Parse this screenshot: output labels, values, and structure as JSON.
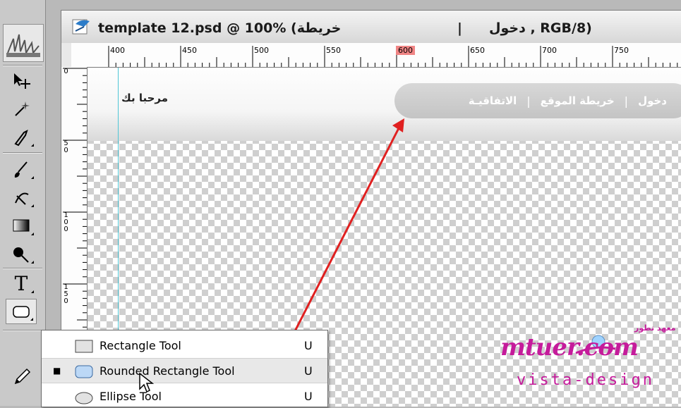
{
  "document": {
    "title_left": "template 12.psd @ 100% (خريطة",
    "title_separator": "|",
    "title_right": "دخول , RGB/8)"
  },
  "ruler": {
    "horizontal_labels": [
      "400",
      "450",
      "500",
      "550",
      "600",
      "650",
      "700",
      "750"
    ],
    "highlighted_label": "600",
    "vertical_labels": [
      "0",
      "50",
      "100",
      "150"
    ]
  },
  "canvas": {
    "welcome_text": "مرحبا بك",
    "nav_items": [
      "دخول",
      "خريطة الموقع",
      "الاتفاقيـة"
    ],
    "nav_separator": "|"
  },
  "watermark": {
    "top_text": "معهد تطور",
    "main_text": "mtuer.com",
    "sub_text": "vista-design"
  },
  "toolbox": {
    "type_tool_glyph": "T"
  },
  "tool_flyout": {
    "items": [
      {
        "label": "Rectangle Tool",
        "shortcut": "U",
        "selected": false
      },
      {
        "label": "Rounded Rectangle Tool",
        "shortcut": "U",
        "selected": true
      },
      {
        "label": "Ellipse Tool",
        "shortcut": "U",
        "selected": false
      }
    ],
    "selected_marker": "■"
  },
  "colors": {
    "arrow": "#e02020",
    "guide": "#4fc6d6",
    "watermark": "#c51b9b",
    "ruler_highlight": "#f08585"
  }
}
